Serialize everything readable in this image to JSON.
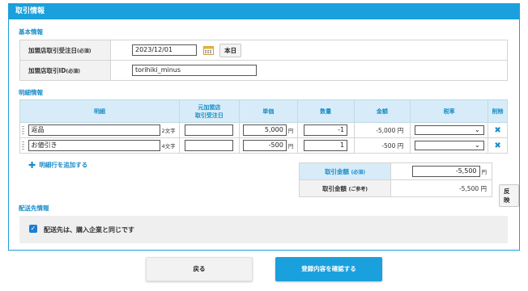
{
  "panel": {
    "title": "取引情報"
  },
  "basic": {
    "section_title": "基本情報",
    "order_date_label": "加盟店取引受注日",
    "order_date_required": "(必須)",
    "order_date_value": "2023/12/01",
    "today_button": "本日",
    "order_id_label": "加盟店取引ID",
    "order_id_required": "(必須)",
    "order_id_value": "torihiki_minus"
  },
  "details": {
    "section_title": "明細情報",
    "headers": {
      "item": "明細",
      "orig_date_line1": "元加盟店",
      "orig_date_line2": "取引受注日",
      "unit_price": "単価",
      "quantity": "数量",
      "amount": "金額",
      "tax_rate": "税率",
      "delete": "削除"
    },
    "rows": [
      {
        "name": "返品",
        "chars": "2文字",
        "orig_date": "",
        "unit_price": "5,000",
        "yen": "円",
        "quantity": "-1",
        "amount": "-5,000 円",
        "tax_rate": ""
      },
      {
        "name": "お値引き",
        "chars": "4文字",
        "orig_date": "",
        "unit_price": "-500",
        "yen": "円",
        "quantity": "1",
        "amount": "-500 円",
        "tax_rate": ""
      }
    ],
    "add_row_label": "明細行を追加する"
  },
  "totals": {
    "amount_label": "取引金額",
    "amount_required": "(必須)",
    "amount_value": "-5,500",
    "amount_unit": "円",
    "reference_label": "取引金額",
    "reference_note": "(ご参考)",
    "reference_value": "-5,500 円",
    "recalc_button": "反映"
  },
  "shipping": {
    "section_title": "配送先情報",
    "same_as_buyer_label": "配送先は、購入企業と同じです",
    "same_as_buyer_checked": true
  },
  "footer": {
    "back_button": "戻る",
    "confirm_button": "登録内容を確認する"
  },
  "colors": {
    "accent": "#1aa0dc",
    "header_bg": "#d7ecf8",
    "label_bg": "#f2f2f2"
  }
}
